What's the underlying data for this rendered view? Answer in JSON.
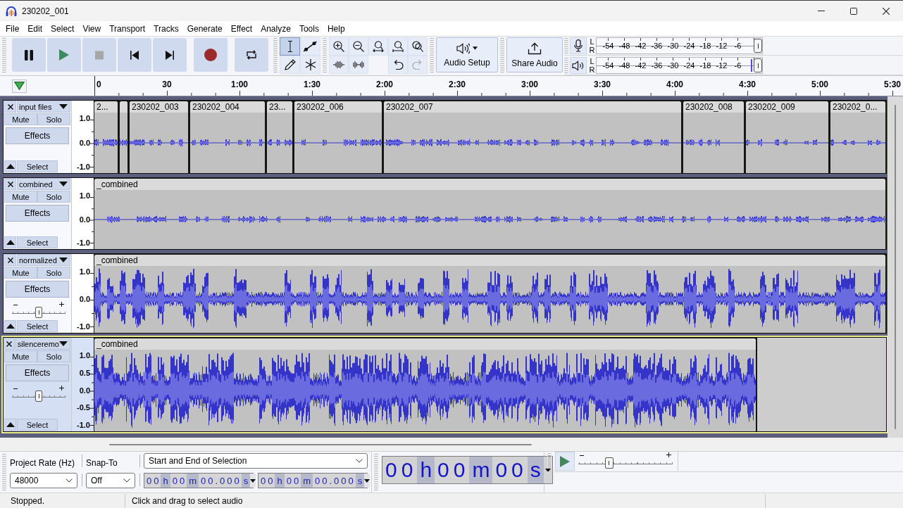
{
  "window": {
    "title": "230202_001"
  },
  "menu": [
    "File",
    "Edit",
    "Select",
    "View",
    "Transport",
    "Tracks",
    "Generate",
    "Effect",
    "Analyze",
    "Tools",
    "Help"
  ],
  "transport": [
    {
      "kind": "pause",
      "disabled": false
    },
    {
      "kind": "play",
      "disabled": false
    },
    {
      "kind": "stop",
      "disabled": true
    },
    {
      "kind": "start",
      "disabled": false
    },
    {
      "kind": "end",
      "disabled": false
    },
    {
      "kind": "record",
      "disabled": false
    },
    {
      "kind": "loop",
      "disabled": false
    }
  ],
  "tools": [
    {
      "kind": "select",
      "selected": true
    },
    {
      "kind": "envelope",
      "selected": false
    },
    {
      "kind": "draw",
      "selected": false
    },
    {
      "kind": "multi",
      "selected": false
    }
  ],
  "edit": [
    {
      "kind": "zoomin",
      "disabled": false
    },
    {
      "kind": "zoomout",
      "disabled": false
    },
    {
      "kind": "fitselection",
      "disabled": false
    },
    {
      "kind": "fitproject",
      "disabled": false
    },
    {
      "kind": "zoomtoggle",
      "disabled": false
    },
    {
      "kind": "trim",
      "disabled": false
    },
    {
      "kind": "silence",
      "disabled": false
    },
    {
      "kind": "undo",
      "disabled": false
    },
    {
      "kind": "redo",
      "disabled": true
    }
  ],
  "audio_setup": {
    "label": "Audio Setup"
  },
  "share_audio": {
    "label": "Share Audio"
  },
  "meters": [
    {
      "kind": "record",
      "channels": [
        "L",
        "R"
      ],
      "scale": [
        "-54",
        "-48",
        "-42",
        "-36",
        "-30",
        "-24",
        "-18",
        "-12",
        "-6"
      ],
      "volume": {
        "level": 1
      }
    },
    {
      "kind": "playback",
      "channels": [
        "L",
        "R"
      ],
      "scale": [
        "-54",
        "-48",
        "-42",
        "-36",
        "-30",
        "-24",
        "-18",
        "-12",
        "-6"
      ],
      "volume": {
        "level": 1
      },
      "peak": {
        "level": 0.93
      }
    }
  ],
  "timeline": {
    "labels": [
      "0",
      "30",
      "1:00",
      "1:30",
      "2:00",
      "2:30",
      "3:00",
      "3:30",
      "4:00",
      "4:30",
      "5:00",
      "5:30"
    ]
  },
  "tracks": [
    {
      "name": "input files",
      "selected": false,
      "mute": "Mute",
      "solo": "Solo",
      "effects": "Effects",
      "select": "Select",
      "scale": [
        "1.0",
        "0.0",
        "-1.0"
      ],
      "clips": [
        {
          "title": "2..."
        },
        {
          "title": "230202_003"
        },
        {
          "title": "230202_004"
        },
        {
          "title": "23..."
        },
        {
          "title": "230202_006"
        },
        {
          "title": "230202_007"
        },
        {
          "title": "230202_008"
        },
        {
          "title": "230202_009"
        },
        {
          "title": "230202_0..."
        }
      ]
    },
    {
      "name": "combined",
      "selected": false,
      "mute": "Mute",
      "solo": "Solo",
      "effects": "Effects",
      "select": "Select",
      "scale": [
        "1.0",
        "0.0",
        "-1.0"
      ],
      "clips": [
        {
          "title": "_combined"
        }
      ]
    },
    {
      "name": "normalized",
      "selected": false,
      "mute": "Mute",
      "solo": "Solo",
      "effects": "Effects",
      "select": "Select",
      "gain": {
        "level": 0.5
      },
      "scale": [
        "1.0",
        "0.0",
        "-1.0"
      ],
      "clips": [
        {
          "title": "_combined"
        }
      ]
    },
    {
      "name": "silenceremo",
      "selected": true,
      "mute": "Mute",
      "solo": "Solo",
      "effects": "Effects",
      "select": "Select",
      "gain": {
        "level": 0.5
      },
      "scale": [
        "1.0",
        "0.5",
        "0.0",
        "-0.5",
        "-1.0"
      ],
      "clips": [
        {
          "title": "_combined"
        }
      ]
    }
  ],
  "project_rate": {
    "label": "Project Rate (Hz)",
    "value": "48000"
  },
  "snap_to": {
    "label": "Snap-To",
    "value": "Off"
  },
  "selection": {
    "mode": "Start and End of Selection",
    "start": [
      "00",
      "h",
      "00",
      "m",
      "00.000",
      "s"
    ],
    "end": [
      "00",
      "h",
      "00",
      "m",
      "00.000",
      "s"
    ]
  },
  "time_display": [
    "00",
    "h",
    "00",
    "m",
    "00",
    "s"
  ],
  "play_at_speed": {
    "level": 0.31
  },
  "status": [
    "Stopped.",
    "Click and drag to select audio"
  ]
}
